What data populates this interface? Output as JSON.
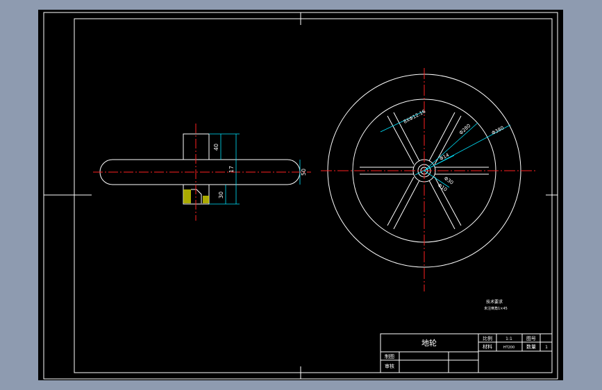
{
  "colors": {
    "background": "#8e9bb0",
    "drawing_area": "#000000",
    "line": "#ffffff",
    "center_line": "#ff2020",
    "dimension": "#00e5ff",
    "hatch": "#c8c800"
  },
  "side_view": {
    "dim_hub_top": "40",
    "dim_total": "17",
    "dim_hub_bottom": "30",
    "dim_rim_width": "50"
  },
  "front_view": {
    "dim_bolt": "8XΦ12.16",
    "dim_inner_rim": "Φ280",
    "dim_outer_rim": "Φ380",
    "dim_hub": "Φ14",
    "dim_bore_1": "Φ30",
    "dim_bore_2": "Φ10"
  },
  "notes": {
    "line1": "技术要求",
    "line2": "未注倒角1×45"
  },
  "title_block": {
    "part_name": "地轮",
    "scale_label": "比例",
    "scale_value": "1:1",
    "drawing_no_label": "图号",
    "material_label": "材料",
    "material_value": "HT200",
    "quantity_label": "数量",
    "quantity_value": "1",
    "drawn_label": "制图",
    "checked_label": "审核"
  }
}
